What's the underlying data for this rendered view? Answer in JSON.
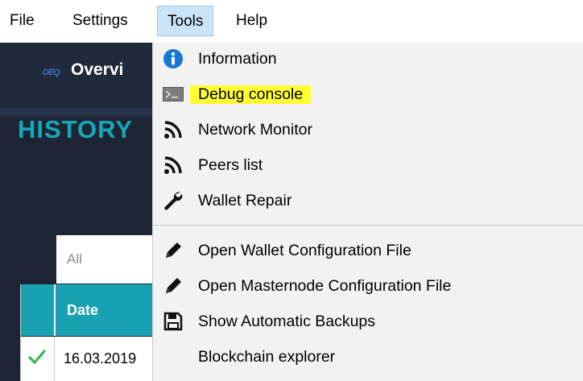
{
  "menubar": {
    "items": [
      "File",
      "Settings",
      "Tools",
      "Help"
    ]
  },
  "app": {
    "logo_text": "DEQ",
    "tab_overview": "Overvi",
    "history_title": "HISTORY",
    "filter_value": "All",
    "table": {
      "header_date": "Date",
      "row_date": "16.03.2019"
    }
  },
  "tools_menu": {
    "items": [
      {
        "label": "Information",
        "icon": "info-icon"
      },
      {
        "label": "Debug console",
        "icon": "console-icon",
        "highlighted": true
      },
      {
        "label": "Network Monitor",
        "icon": "network-icon"
      },
      {
        "label": "Peers list",
        "icon": "peers-icon"
      },
      {
        "label": "Wallet Repair",
        "icon": "wrench-icon"
      },
      {
        "label": "Open Wallet Configuration File",
        "icon": "pencil-icon"
      },
      {
        "label": "Open Masternode Configuration File",
        "icon": "pencil-icon"
      },
      {
        "label": "Show Automatic Backups",
        "icon": "save-icon"
      },
      {
        "label": "Blockchain explorer",
        "icon": ""
      }
    ]
  },
  "colors": {
    "highlight": "#ffff33",
    "accent": "#17a1b1",
    "app_bg": "#1e2737"
  }
}
